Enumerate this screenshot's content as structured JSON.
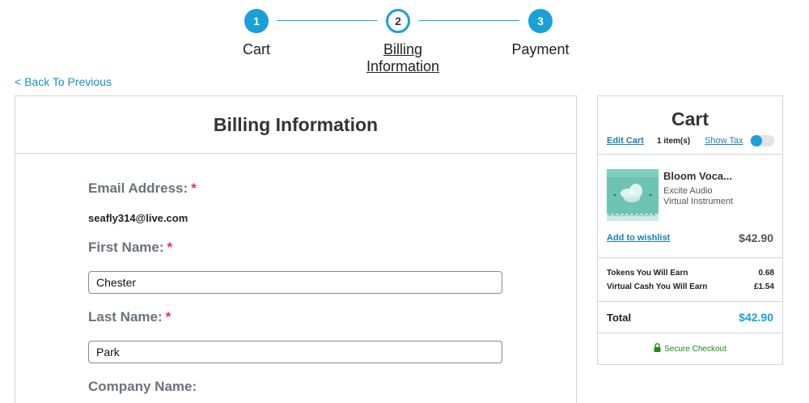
{
  "stepper": {
    "steps": [
      {
        "number": "1",
        "label": "Cart"
      },
      {
        "number": "2",
        "label_line1": "Billing",
        "label_line2": "Information"
      },
      {
        "number": "3",
        "label": "Payment"
      }
    ]
  },
  "nav": {
    "back_label": "< Back To Previous"
  },
  "billing": {
    "title": "Billing Information",
    "email_label": "Email Address:",
    "email_value": "seafly314@live.com",
    "first_name_label": "First Name:",
    "first_name_value": "Chester",
    "last_name_label": "Last Name:",
    "last_name_value": "Park",
    "company_label": "Company Name:",
    "required_mark": "*"
  },
  "cart": {
    "title": "Cart",
    "edit_label": "Edit Cart",
    "item_count": "1 item(s)",
    "show_tax_label": "Show Tax",
    "item": {
      "name": "Bloom Voca...",
      "brand": "Excite Audio",
      "type": "Virtual Instrument",
      "wishlist_label": "Add to wishlist",
      "price": "$42.90"
    },
    "tokens_label": "Tokens You Will Earn",
    "tokens_value": "0.68",
    "vcash_label": "Virtual Cash You Will Earn",
    "vcash_value": "£1.54",
    "total_label": "Total",
    "total_value": "$42.90",
    "secure_label": "Secure Checkout"
  },
  "colors": {
    "accent": "#1aa0d8",
    "link": "#1a7fb5",
    "required": "#e0364b",
    "secure": "#1e8a1e"
  },
  "icons": {
    "secure": "lock-icon",
    "toggle": "toggle-switch"
  }
}
